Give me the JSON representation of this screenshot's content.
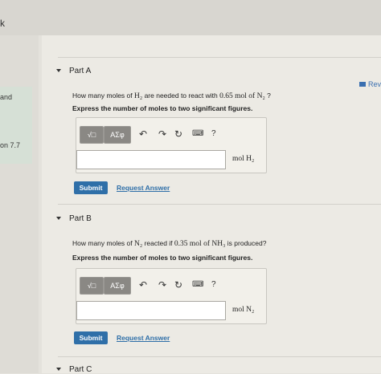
{
  "left_panel": {
    "frag_top": "k",
    "frag_and": "and",
    "frag_on": "on 7.7"
  },
  "header": {
    "review_label": "Rev"
  },
  "parts": [
    {
      "title": "Part A",
      "question_prefix": "How many moles of",
      "reactant": "H₂",
      "question_mid": "are needed to react with",
      "quantity": "0.65 mol of N₂",
      "question_suffix": "?",
      "instruction": "Express the number of moles to two significant figures.",
      "toolbar": {
        "templates": "√□",
        "symbols": "ΑΣφ",
        "help": "?"
      },
      "input_value": "",
      "unit": "mol H₂",
      "submit_label": "Submit",
      "request_label": "Request Answer"
    },
    {
      "title": "Part B",
      "question_prefix": "How many moles of",
      "reactant": "N₂",
      "question_mid": "reacted if",
      "quantity": "0.35 mol of NH₃",
      "question_suffix": "is produced?",
      "instruction": "Express the number of moles to two significant figures.",
      "toolbar": {
        "templates": "√□",
        "symbols": "ΑΣφ",
        "help": "?"
      },
      "input_value": "",
      "unit": "mol N₂",
      "submit_label": "Submit",
      "request_label": "Request Answer"
    },
    {
      "title": "Part C"
    }
  ]
}
